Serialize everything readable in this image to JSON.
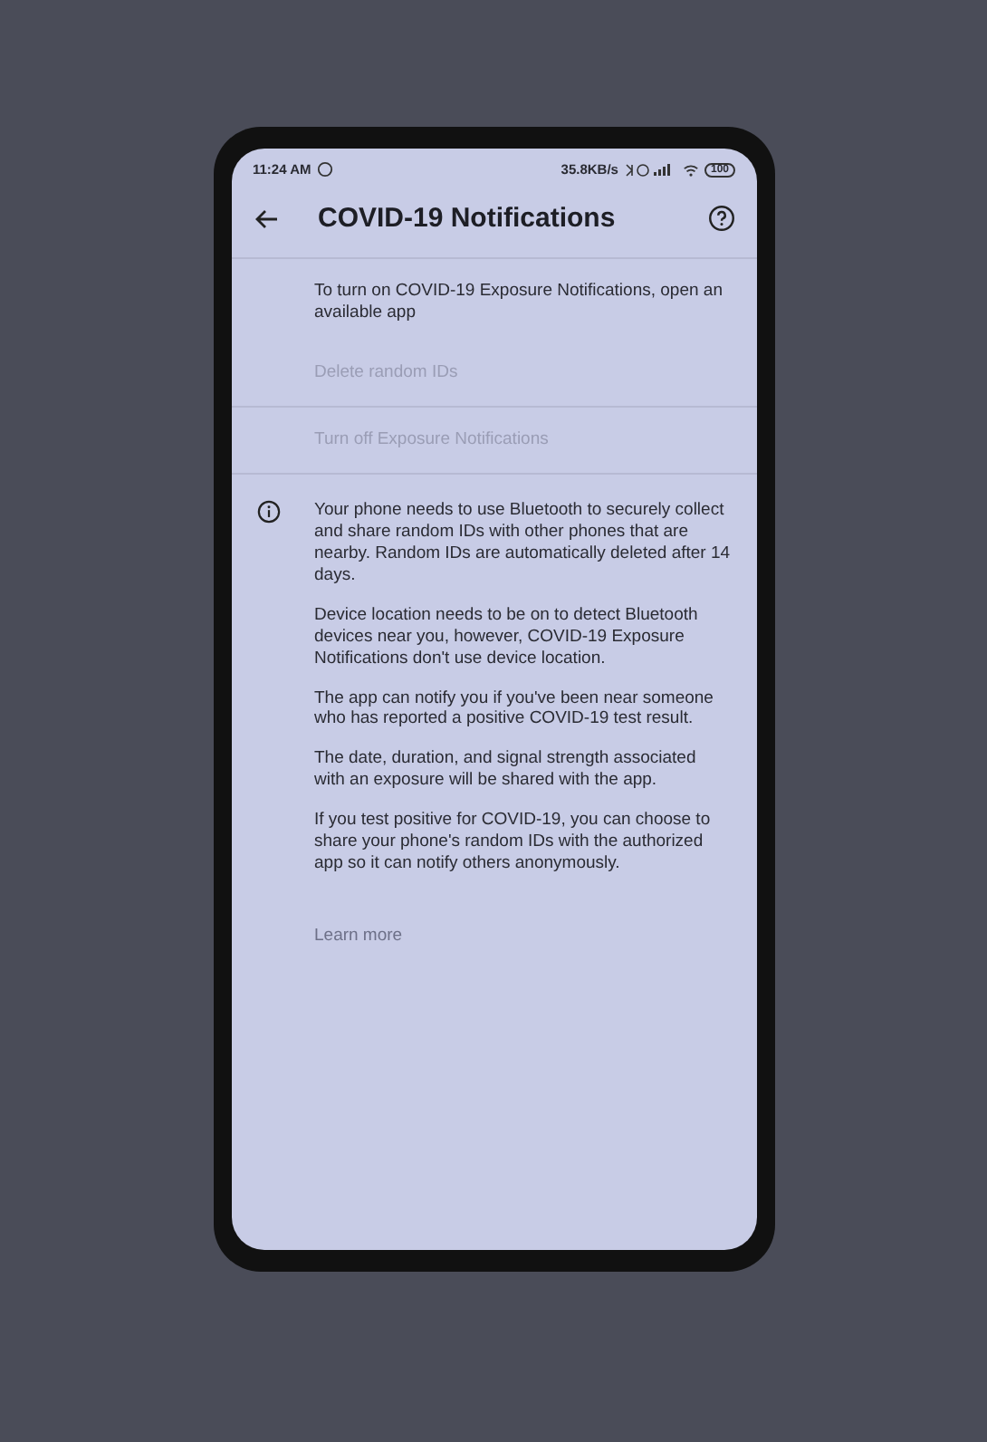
{
  "status_bar": {
    "time": "11:24 AM",
    "speed": "35.8KB/s",
    "battery": "100"
  },
  "app_bar": {
    "title": "COVID-19 Notifications"
  },
  "intro": "To turn on COVID-19 Exposure Notifications, open an available app",
  "actions": [
    {
      "label": "Delete random IDs",
      "disabled": true
    },
    {
      "label": "Turn off Exposure Notifications",
      "disabled": true
    }
  ],
  "info_paragraphs": [
    "Your phone needs to use Bluetooth to securely collect and share random IDs with other phones that are nearby. Random IDs are automatically deleted after 14 days.",
    "Device location needs to be on to detect Bluetooth devices near you, however, COVID-19 Exposure Notifications don't use device location.",
    "The app can notify you if you've been near someone who has reported a positive COVID-19 test result.",
    "The date, duration, and signal strength associated with an exposure will be shared with the app.",
    "If you test positive for COVID-19, you can choose to share your phone's random IDs with the authorized app so it can notify others anonymously."
  ],
  "learn_more": "Learn more"
}
